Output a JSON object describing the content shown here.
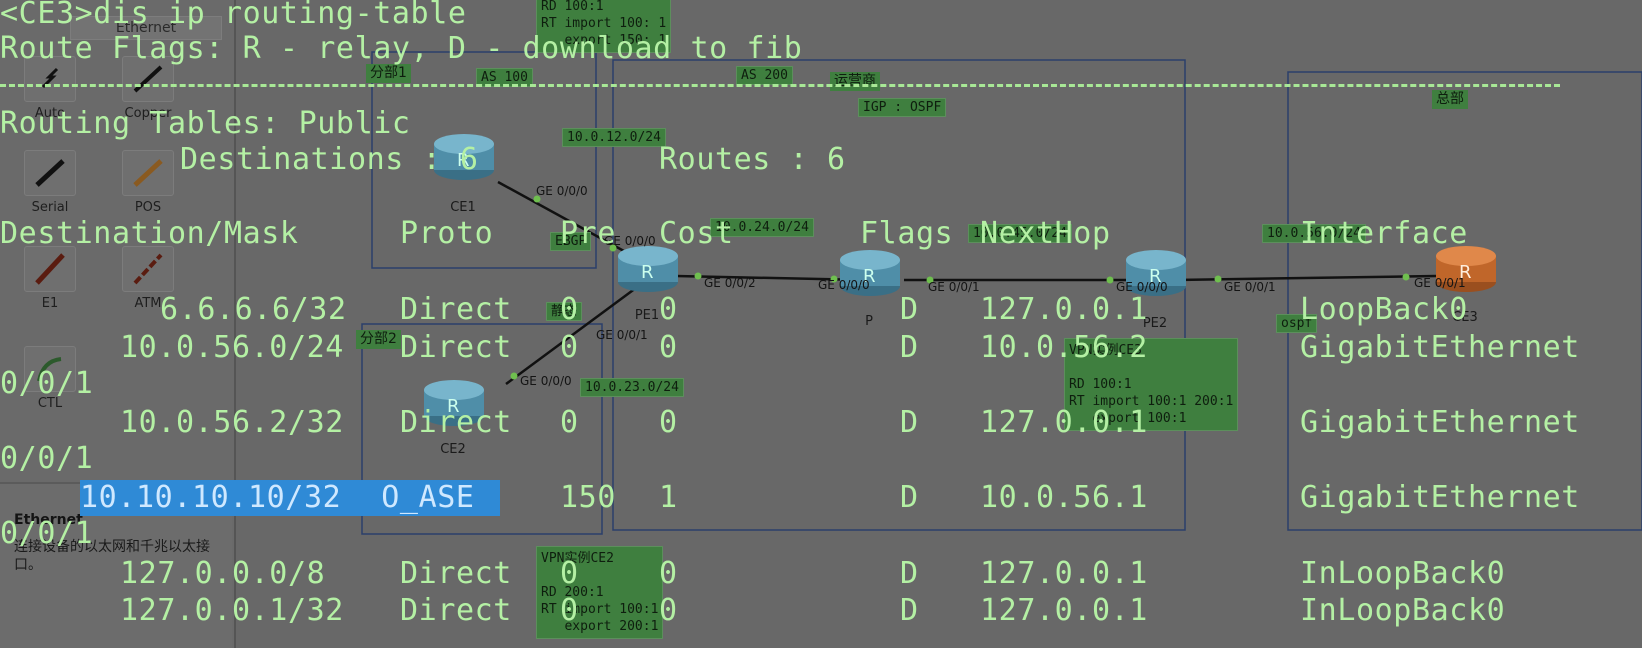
{
  "palette": {
    "header": "Ethernet",
    "items": [
      {
        "label": "Auto",
        "icon": "auto-cable-icon"
      },
      {
        "label": "Copper",
        "icon": "copper-cable-icon"
      },
      {
        "label": "Serial",
        "icon": "serial-cable-icon"
      },
      {
        "label": "POS",
        "icon": "pos-cable-icon"
      },
      {
        "label": "E1",
        "icon": "e1-cable-icon"
      },
      {
        "label": "ATM",
        "icon": "atm-cable-icon"
      },
      {
        "label": "CTL",
        "icon": "ctl-cable-icon"
      }
    ],
    "desc_title": "Ethernet",
    "desc_text": "连接设备的以太网和千兆以太接口。"
  },
  "topology": {
    "zones": {
      "branch1": "分部1",
      "branch2": "分部2",
      "carrier": "运营商",
      "hq": "总部",
      "as100": "AS 100",
      "as200": "AS 200",
      "igp": "IGP : OSPF",
      "ebgp": "EBGP",
      "static": "静态",
      "ospf": "ospf"
    },
    "subnets": {
      "s12": "10.0.12.0/24",
      "s24": "10.0.24.0/24",
      "s23": "10.0.23.0/24",
      "s45": "10.0.45.0/24",
      "s56": "10.0.56.0/24"
    },
    "devices": {
      "ce1": "CE1",
      "ce2": "CE2",
      "pe1": "PE1",
      "p": "P",
      "pe2": "PE2",
      "ce3": "CE3"
    },
    "ports": {
      "ce1_g0": "GE 0/0/0",
      "pe1_g0": "GE 0/0/0",
      "pe1_g1": "GE 0/0/1",
      "pe1_g2": "GE 0/0/2",
      "ce2_g0": "GE 0/0/0",
      "p_g0": "GE 0/0/0",
      "p_g1": "GE 0/0/1",
      "pe2_g0": "GE 0/0/0",
      "pe2_g1": "GE 0/0/1",
      "ce3_g1": "GE 0/0/1"
    },
    "vpn_top": "RD 100:1\nRT import 100: 1\n   export 150: 1",
    "vpn_ce3": "VPN实例CE3\n\nRD 100:1\nRT import 100:1 200:1\n   export 100:1",
    "vpn_ce2": "VPN实例CE2\n\nRD 200:1\nRT import 100:1\n   export 200:1"
  },
  "terminal": {
    "prompt_line": "<CE3>dis ip routing-table",
    "flags_line": "Route Flags: R - relay, D - download to fib",
    "tables_line": "Routing Tables: Public",
    "destinations_line": "Destinations : 6",
    "routes_line": "Routes : 6",
    "headers": {
      "dest": "Destination/Mask",
      "proto": "Proto",
      "pre": "Pre",
      "cost": "Cost",
      "flags": "Flags",
      "nexthop": "NextHop",
      "iface": "Interface"
    },
    "rows": [
      {
        "dest": "6.6.6.6/32",
        "proto": "Direct",
        "pre": "0",
        "cost": "0",
        "flags": "D",
        "nexthop": "127.0.0.1",
        "iface": "LoopBack0",
        "iface2": ""
      },
      {
        "dest": "10.0.56.0/24",
        "proto": "Direct",
        "pre": "0",
        "cost": "0",
        "flags": "D",
        "nexthop": "10.0.56.2",
        "iface": "GigabitEthernet",
        "iface2": "0/0/1"
      },
      {
        "dest": "10.0.56.2/32",
        "proto": "Direct",
        "pre": "0",
        "cost": "0",
        "flags": "D",
        "nexthop": "127.0.0.1",
        "iface": "GigabitEthernet",
        "iface2": "0/0/1"
      },
      {
        "dest": "10.10.10.10/32",
        "proto": "O_ASE",
        "pre": "150",
        "cost": "1",
        "flags": "D",
        "nexthop": "10.0.56.1",
        "iface": "GigabitEthernet",
        "iface2": "0/0/1"
      },
      {
        "dest": "127.0.0.0/8",
        "proto": "Direct",
        "pre": "0",
        "cost": "0",
        "flags": "D",
        "nexthop": "127.0.0.1",
        "iface": "InLoopBack0",
        "iface2": ""
      },
      {
        "dest": "127.0.0.1/32",
        "proto": "Direct",
        "pre": "0",
        "cost": "0",
        "flags": "D",
        "nexthop": "127.0.0.1",
        "iface": "InLoopBack0",
        "iface2": ""
      }
    ]
  },
  "colors": {
    "terminal_text": "#b4f0a4",
    "selection": "#2f8ad6",
    "label_box": "#3f7f3f",
    "background": "#686868"
  }
}
